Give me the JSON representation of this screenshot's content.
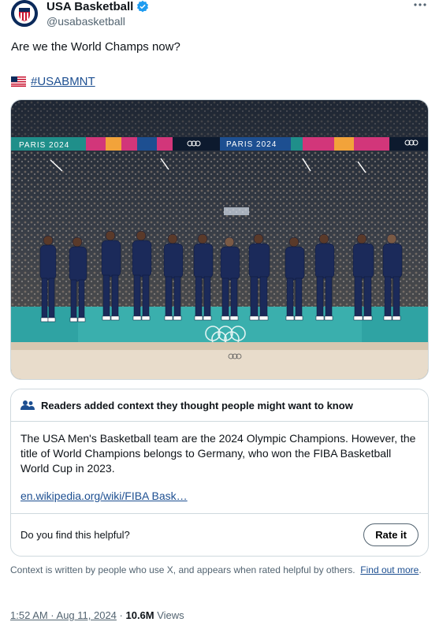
{
  "author": {
    "display_name": "USA Basketball",
    "handle": "@usabasketball",
    "avatar_icon": "usa-basketball-logo-icon",
    "verified_icon": "verified-badge-icon",
    "more_icon": "more-horizontal-icon"
  },
  "tweet": {
    "text": "Are we the World Champs now?",
    "flag_icon": "us-flag-icon",
    "hashtag": "#USABMNT",
    "media_icon": "team-podium-photo"
  },
  "photo": {
    "banner_left": "PARIS 2024",
    "banner_right": "PARIS 2024"
  },
  "community_note": {
    "header": "Readers added context they thought people might want to know",
    "header_icon": "people-icon",
    "body": "The USA Men's Basketball team are the 2024 Olympic Champions. However, the title of World Champions belongs to Germany, who won the FIBA Basketball World Cup in 2023.",
    "link": "en.wikipedia.org/wiki/FIBA Bask…",
    "helpful_prompt": "Do you find this helpful?",
    "rate_button": "Rate it"
  },
  "context_note": {
    "text": "Context is written by people who use X, and appears when rated helpful by others.",
    "link": "Find out more",
    "punct": "."
  },
  "meta": {
    "timestamp": "1:52 AM · Aug 11, 2024",
    "separator": " · ",
    "views_count": "10.6M",
    "views_label": " Views"
  },
  "colors": {
    "link": "#1d4f91",
    "secondary_text": "#536471",
    "border": "#cfd9de",
    "uniform_navy": "#1b2a5a",
    "court_teal": "#2fa3a3"
  }
}
